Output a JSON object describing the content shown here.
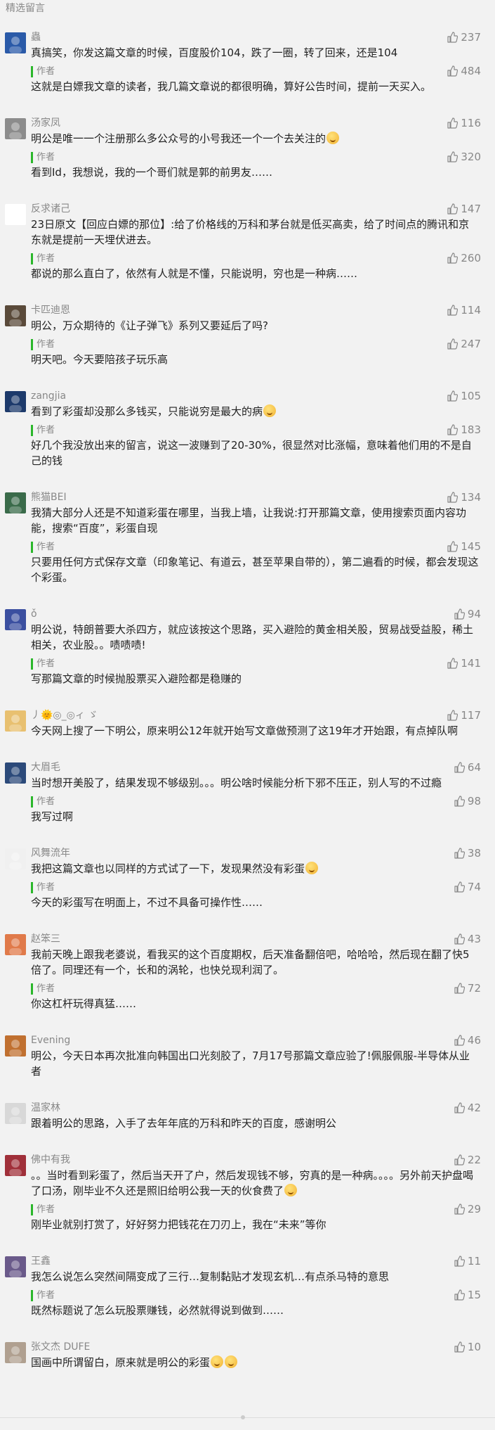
{
  "header": {
    "title": "精选留言"
  },
  "reply_label": "作者",
  "comments": [
    {
      "name": "蟲",
      "likes": "237",
      "text": "真搞笑，你发这篇文章的时候，百度股价104，跌了一圈，转了回来，还是104",
      "reply_likes": "484",
      "reply": "这就是白嫖我文章的读者，我几篇文章说的都很明确，算好公告时间，提前一天买入。",
      "avatar_color": "#2a5aa8"
    },
    {
      "name": "汤家凤",
      "likes": "116",
      "text": "明公是唯一一个注册那么多公众号的小号我还一个一个去关注的",
      "emoji_after": true,
      "reply_likes": "320",
      "reply": "看到Id，我想说，我的一个哥们就是郭的前男友……",
      "avatar_color": "#8c8c8c"
    },
    {
      "name": "反求诸己",
      "likes": "147",
      "text": "23日原文【回应白嫖的那位】:给了价格线的万科和茅台就是低买高卖，给了时间点的腾讯和京东就是提前一天埋伏进去。",
      "reply_likes": "260",
      "reply": "都说的那么直白了，依然有人就是不懂，只能说明，穷也是一种病……",
      "avatar_color": "#ffffff"
    },
    {
      "name": "卡匹迪恩",
      "likes": "114",
      "text": "明公，万众期待的《让子弹飞》系列又要延后了吗?",
      "reply_likes": "247",
      "reply": "明天吧。今天要陪孩子玩乐高",
      "avatar_color": "#5a4a3a"
    },
    {
      "name": "zangjia",
      "likes": "105",
      "text": "看到了彩蛋却没那么多钱买，只能说穷是最大的病",
      "emoji_after": true,
      "reply_likes": "183",
      "reply": "好几个我没放出来的留言，说这一波赚到了20-30%，很显然对比涨幅，意味着他们用的不是自己的钱",
      "avatar_color": "#1d3a6b"
    },
    {
      "name": "熊猫BEI",
      "likes": "134",
      "text": "我猜大部分人还是不知道彩蛋在哪里，当我上墙，让我说:打开那篇文章，使用搜索页面内容功能，搜索“百度”，彩蛋自现",
      "reply_likes": "145",
      "reply": "只要用任何方式保存文章（印象笔记、有道云，甚至苹果自带的），第二遍看的时候，都会发现这个彩蛋。",
      "avatar_color": "#3a6b4a"
    },
    {
      "name": "ǒ",
      "likes": "94",
      "text": "明公说，特朗普要大杀四方，就应该按这个思路，买入避险的黄金相关股，贸易战受益股，稀土相关，农业股。。啧啧啧!",
      "reply_likes": "141",
      "reply": "写那篇文章的时候抛股票买入避险都是稳赚的",
      "avatar_color": "#3b4fa0"
    },
    {
      "name": "丿🌞◎_◎ィ ゞ",
      "likes": "117",
      "text": "今天网上搜了一下明公，原来明公12年就开始写文章做预测了这19年才开始跟，有点掉队啊",
      "emoji_inline": true,
      "reply_likes": "",
      "reply": "",
      "avatar_color": "#e8c070"
    },
    {
      "name": "大眉毛",
      "likes": "64",
      "text": "当时想开美股了，结果发现不够级别。。。明公啥时候能分析下邪不压正，别人写的不过瘾",
      "reply_likes": "98",
      "reply": "我写过啊",
      "avatar_color": "#2c4a7a"
    },
    {
      "name": "风舞流年",
      "likes": "38",
      "text": "我把这篇文章也以同样的方式试了一下，发现果然没有彩蛋",
      "emoji_after": true,
      "reply_likes": "74",
      "reply": "今天的彩蛋写在明面上，不过不具备可操作性……",
      "avatar_color": "#f0f0f0"
    },
    {
      "name": "赵笨三",
      "likes": "43",
      "text": "我前天晚上跟我老婆说，看我买的这个百度期权，后天准备翻倍吧，哈哈哈，然后现在翻了快5倍了。同理还有一个，长和的涡轮，也快兑现利润了。",
      "reply_likes": "72",
      "reply": "你这杠杆玩得真猛……",
      "avatar_color": "#e07a4a"
    },
    {
      "name": "Evening",
      "likes": "46",
      "text": "明公，今天日本再次批准向韩国出口光刻胶了，7月17号那篇文章应验了!佩服佩服-半导体从业者",
      "reply_likes": "",
      "reply": "",
      "avatar_color": "#c07030"
    },
    {
      "name": "温家林",
      "likes": "42",
      "text": "跟着明公的思路，入手了去年年底的万科和昨天的百度，感谢明公",
      "reply_likes": "",
      "reply": "",
      "avatar_color": "#d8d8d8"
    },
    {
      "name": "佛中有我",
      "likes": "22",
      "text": "。。当时看到彩蛋了，然后当天开了户，然后发现钱不够，穷真的是一种病。。。。另外前天护盘喝了口汤，刚毕业不久还是照旧给明公我一天的伙食费了",
      "emoji_after": true,
      "reply_likes": "29",
      "reply": "刚毕业就别打赏了，好好努力把钱花在刀刃上，我在“未来”等你",
      "avatar_color": "#a0303a"
    },
    {
      "name": "王鑫",
      "likes": "11",
      "text": "我怎么说怎么突然间隔变成了三行…复制黏贴才发现玄机…有点杀马特的意思",
      "reply_likes": "15",
      "reply": "既然标题说了怎么玩股票赚钱，必然就得说到做到……",
      "avatar_color": "#6a5a8a"
    },
    {
      "name": "张文杰 DUFE",
      "likes": "10",
      "text": "国画中所谓留白，原来就是明公的彩蛋",
      "emoji_double": true,
      "reply_likes": "",
      "reply": "",
      "avatar_color": "#b0a090"
    }
  ]
}
